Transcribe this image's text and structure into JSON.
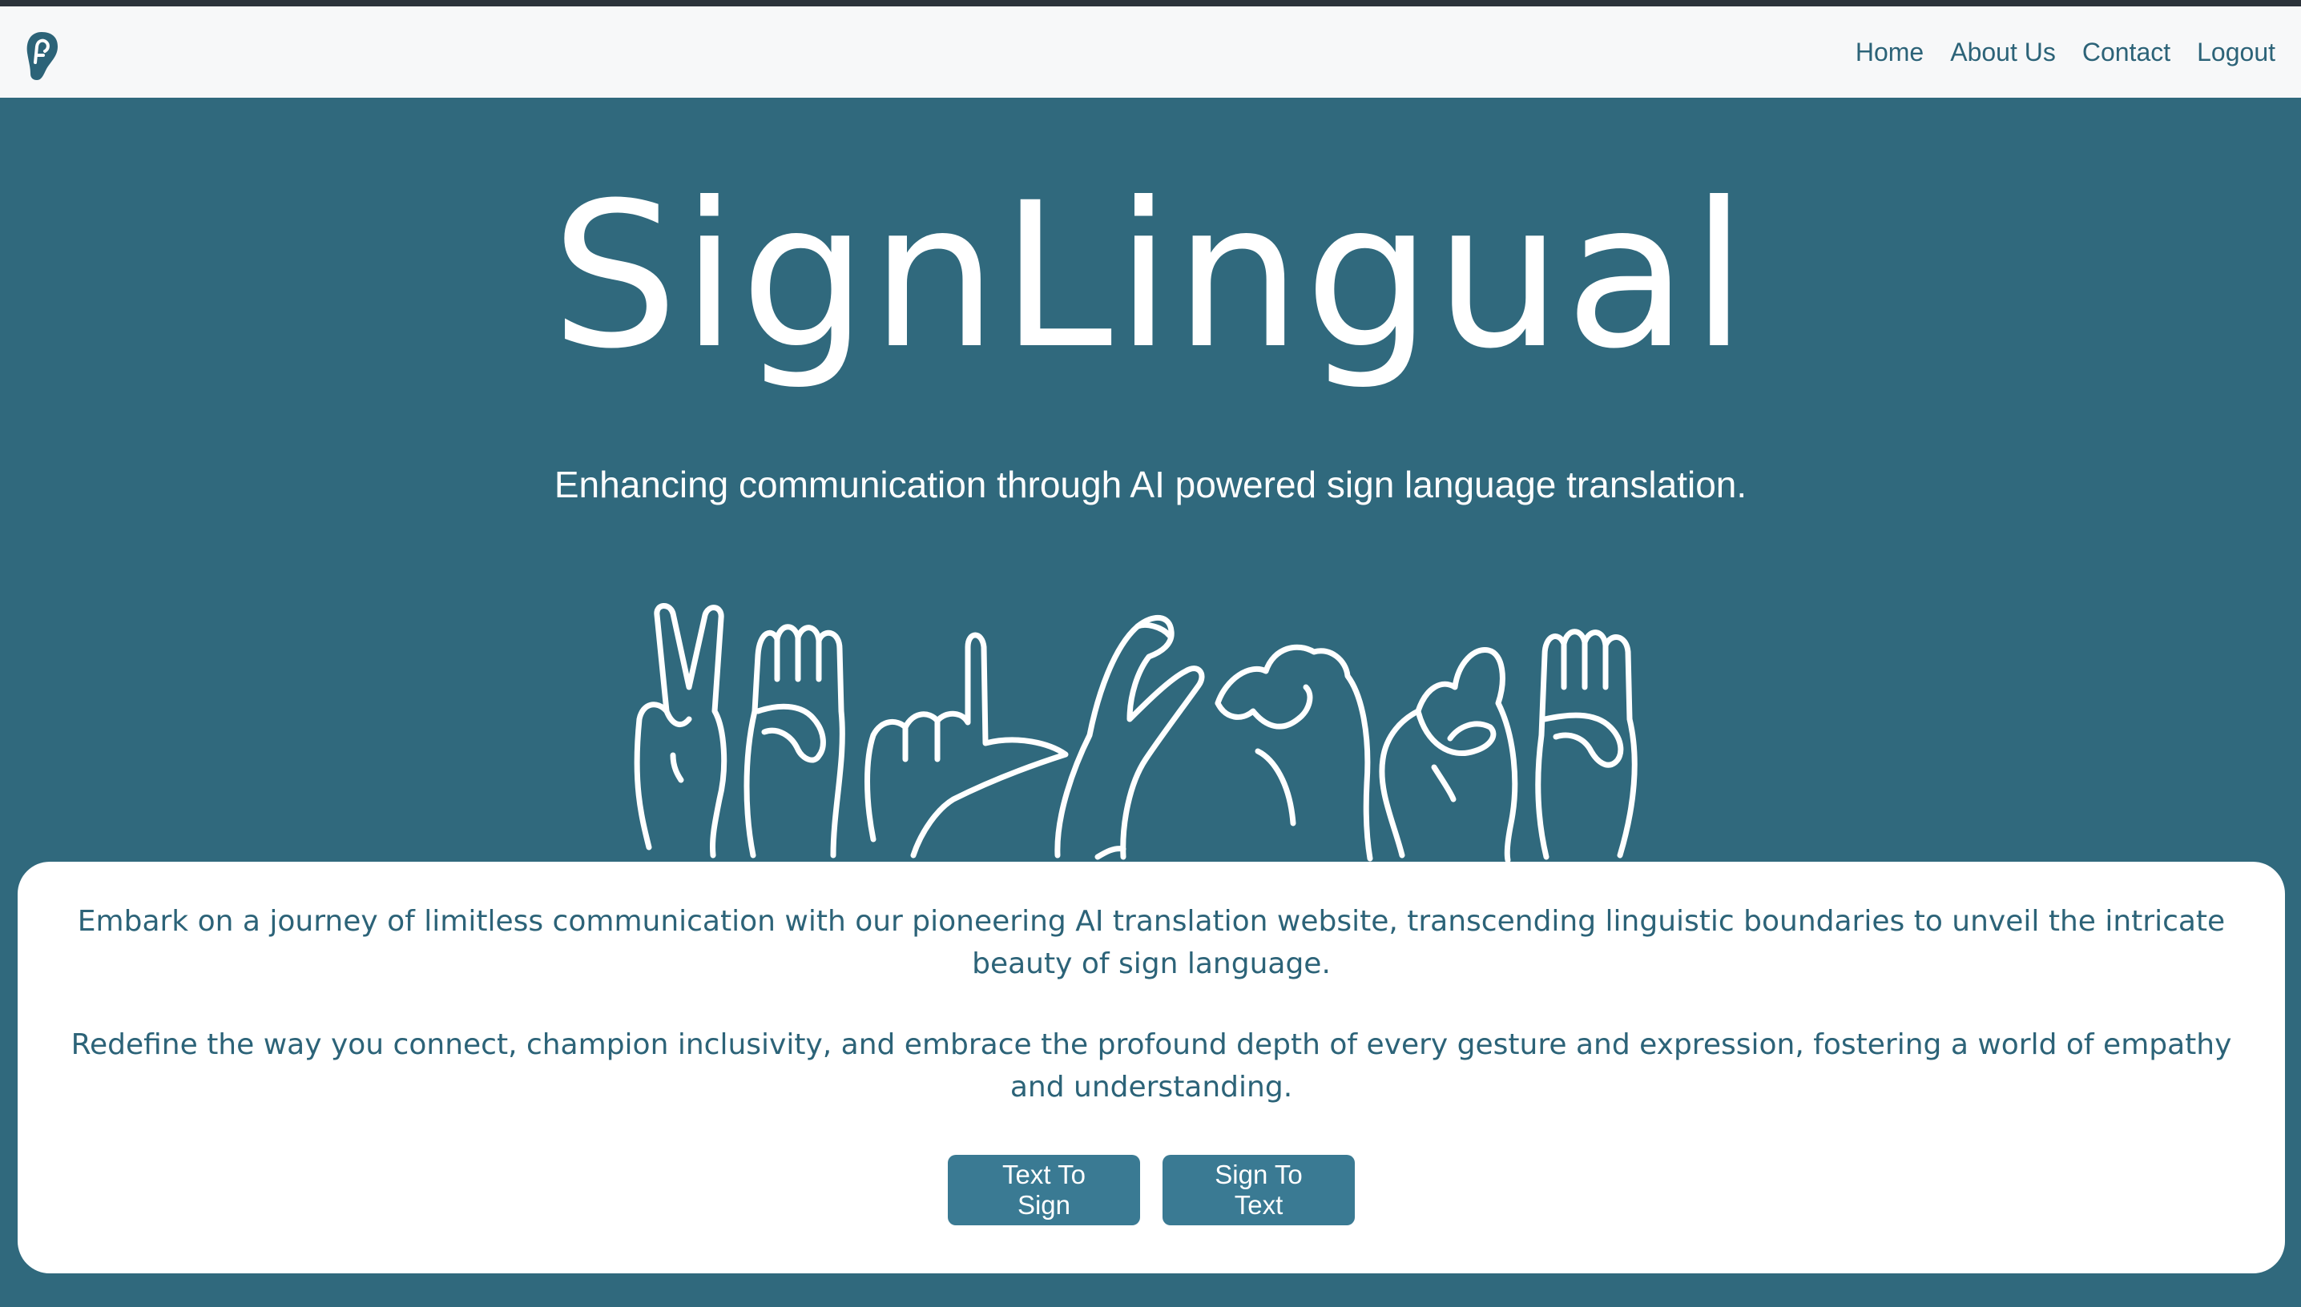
{
  "nav": {
    "links": [
      "Home",
      "About Us",
      "Contact",
      "Logout"
    ]
  },
  "hero": {
    "title": "SignLingual",
    "tagline": "Enhancing communication through AI powered sign language translation."
  },
  "card": {
    "paragraph1": "Embark on a journey of limitless communication with our pioneering AI translation website, transcending linguistic boundaries to unveil the intricate beauty of sign language.",
    "paragraph2": "Redefine the way you connect, champion inclusivity, and embrace the profound depth of every gesture and expression, fostering a world of empathy and understanding.",
    "buttons": [
      "Text To Sign",
      "Sign To Text"
    ]
  },
  "icons": {
    "logo": "ear-icon",
    "illustration": "sign-language-hands-illustration"
  },
  "colors": {
    "background": "#30697d",
    "navbar": "#f7f8f9",
    "accent": "#2c6378",
    "button": "#3a7a93",
    "card": "#ffffff"
  }
}
